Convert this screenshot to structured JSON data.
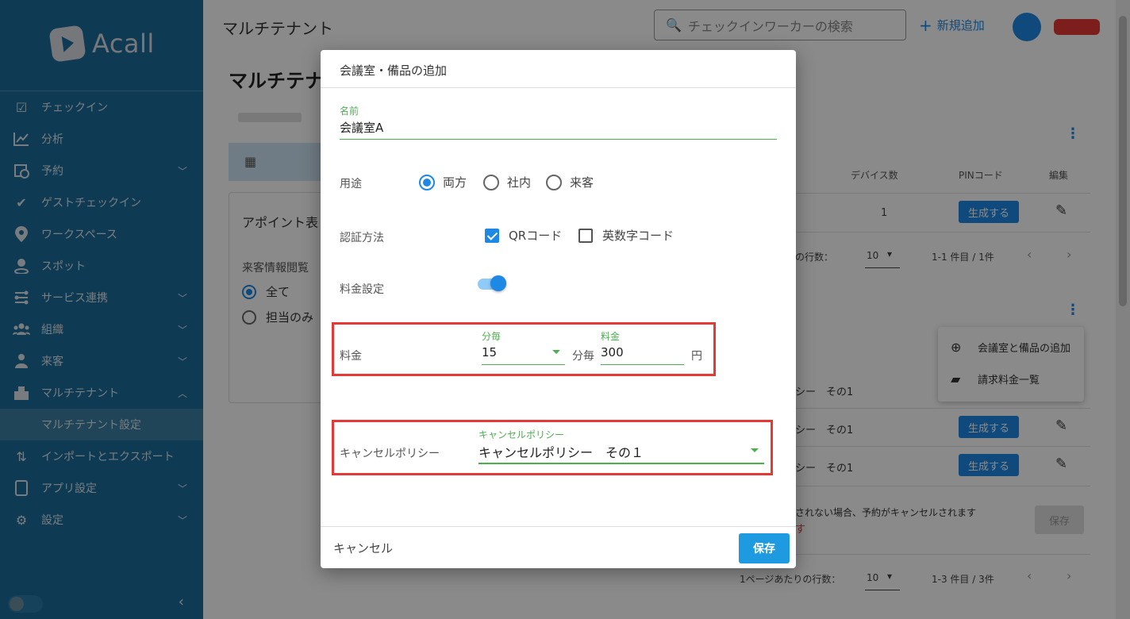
{
  "sidebar": {
    "logo_text": "Acall",
    "items": [
      {
        "label": "チェックイン",
        "icon": "checkbox-icon"
      },
      {
        "label": "分析",
        "icon": "chart-line-icon"
      },
      {
        "label": "予約",
        "icon": "calendar-clock-icon"
      },
      {
        "label": "ゲストチェックイン",
        "icon": "check-icon"
      },
      {
        "label": "ワークスペース",
        "icon": "location-pin-icon"
      },
      {
        "label": "スポット",
        "icon": "person-pin-icon"
      },
      {
        "label": "サービス連携",
        "icon": "integration-icon"
      },
      {
        "label": "組織",
        "icon": "people-group-icon"
      },
      {
        "label": "来客",
        "icon": "visitor-icon"
      },
      {
        "label": "マルチテナント",
        "icon": "building-icon"
      },
      {
        "label": "マルチテナント設定",
        "icon": ""
      },
      {
        "label": "インポートとエクスポート",
        "icon": "import-export-icon"
      },
      {
        "label": "アプリ設定",
        "icon": "tablet-icon"
      },
      {
        "label": "設定",
        "icon": "gears-icon"
      }
    ]
  },
  "topbar": {
    "title": "マルチテナント",
    "search_placeholder": "チェックインワーカーの検索",
    "add_new": "新規追加"
  },
  "background": {
    "page_title": "マルチテナント",
    "card_title": "アポイント表",
    "card_label": "来客情報閲覧",
    "radio_all": "全て",
    "radio_mine": "担当のみ",
    "table_headers": {
      "devices": "デバイス数",
      "pin": "PINコード",
      "edit": "編集"
    },
    "row1_devices": "1",
    "generate": "生成する",
    "rows_per_page": "の行数：",
    "rows_per_page_full": "1ページあたりの行数：",
    "rows_value": "10",
    "page_info_1": "1-1 件目 / 1件",
    "page_info_2": "1-3 件目 / 3件",
    "policy_rows": [
      "シー　その1",
      "シー　その1",
      "シー　その1"
    ],
    "notice": "されない場合、予約がキャンセルされます",
    "notice_red": "す",
    "save": "保存",
    "menu": {
      "add_room": "会議室と備品の追加",
      "billing_list": "請求料金一覧"
    }
  },
  "dialog": {
    "title": "会議室・備品の追加",
    "name_label": "名前",
    "name_value": "会議室A",
    "usage_label": "用途",
    "usage_options": [
      "両方",
      "社内",
      "来客"
    ],
    "usage_selected": "両方",
    "auth_label": "認証方法",
    "auth_options": [
      {
        "label": "QRコード",
        "checked": true
      },
      {
        "label": "英数字コード",
        "checked": false
      }
    ],
    "fee_setting_label": "料金設定",
    "fee_setting_on": true,
    "fee_label": "料金",
    "per_minutes_label": "分毎",
    "per_minutes_value": "15",
    "per_minutes_unit": "分毎",
    "price_label": "料金",
    "price_value": "300",
    "price_unit": "円",
    "cancel_policy_label": "キャンセルポリシー",
    "cancel_policy_field_label": "キャンセルポリシー",
    "cancel_policy_value": "キャンセルポリシー　その１",
    "cancel_button": "キャンセル",
    "save_button": "保存"
  },
  "colors": {
    "sidebar": "#1b6e99",
    "accent": "#1e88e5",
    "field_green": "#4caf50",
    "highlight_red": "#e53935"
  }
}
